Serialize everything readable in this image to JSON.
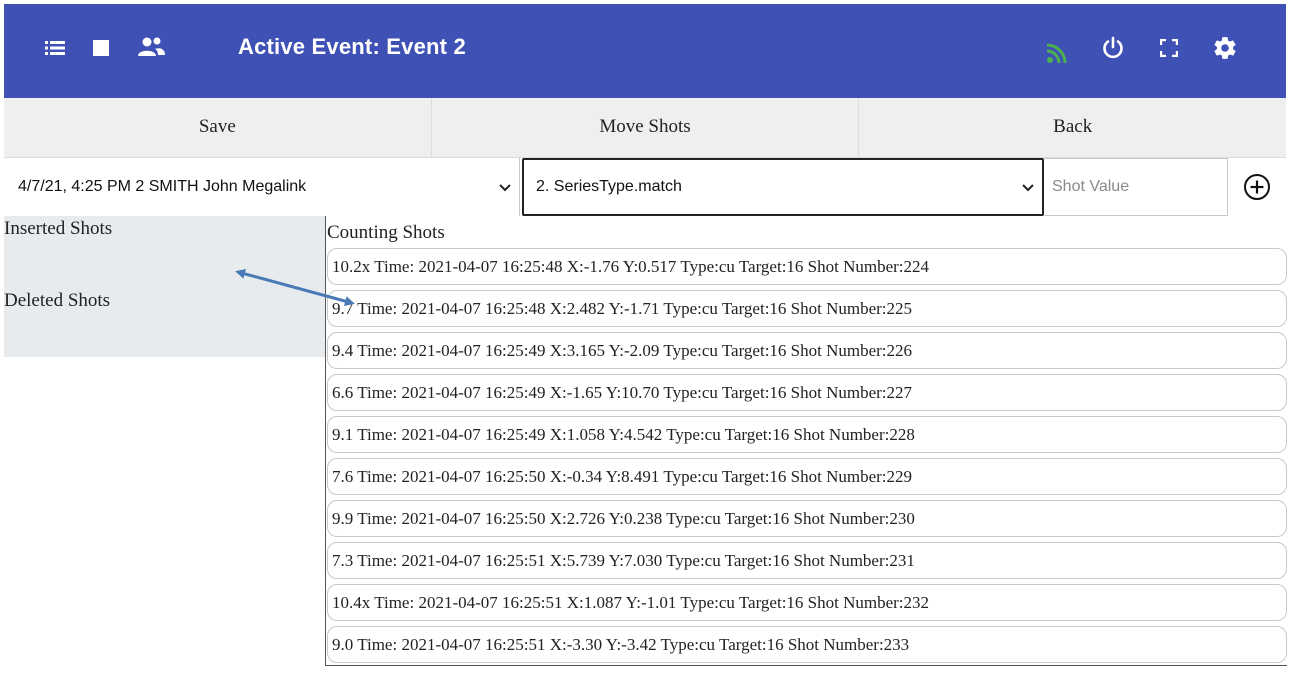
{
  "appbar": {
    "title": "Active Event: Event 2",
    "left_icons": [
      "list-icon",
      "stop-icon",
      "group-icon"
    ],
    "right_icons": [
      "rss-icon",
      "power-icon",
      "fullscreen-icon",
      "gear-icon"
    ],
    "bar_color": "#3f51b5",
    "rss_color": "#4caf50"
  },
  "actions": {
    "save": "Save",
    "move": "Move Shots",
    "back": "Back"
  },
  "selectors": {
    "shooter": "4/7/21, 4:25 PM 2 SMITH John Megalink",
    "series": "2. SeriesType.match",
    "shot_value_placeholder": "Shot Value"
  },
  "left_panel": {
    "inserted": "Inserted Shots",
    "deleted": "Deleted Shots"
  },
  "list": {
    "heading": "Counting Shots",
    "rows": [
      "10.2x Time: 2021-04-07 16:25:48 X:-1.76 Y:0.517 Type:cu Target:16 Shot Number:224",
      "9.7 Time: 2021-04-07 16:25:48 X:2.482 Y:-1.71 Type:cu Target:16 Shot Number:225",
      "9.4 Time: 2021-04-07 16:25:49 X:3.165 Y:-2.09 Type:cu Target:16 Shot Number:226",
      "6.6 Time: 2021-04-07 16:25:49 X:-1.65 Y:10.70 Type:cu Target:16 Shot Number:227",
      "9.1 Time: 2021-04-07 16:25:49 X:1.058 Y:4.542 Type:cu Target:16 Shot Number:228",
      "7.6 Time: 2021-04-07 16:25:50 X:-0.34 Y:8.491 Type:cu Target:16 Shot Number:229",
      "9.9 Time: 2021-04-07 16:25:50 X:2.726 Y:0.238 Type:cu Target:16 Shot Number:230",
      "7.3 Time: 2021-04-07 16:25:51 X:5.739 Y:7.030 Type:cu Target:16 Shot Number:231",
      "10.4x Time: 2021-04-07 16:25:51 X:1.087 Y:-1.01 Type:cu Target:16 Shot Number:232",
      "9.0 Time: 2021-04-07 16:25:51 X:-3.30 Y:-3.42 Type:cu Target:16 Shot Number:233"
    ]
  },
  "annotation_arrow": {
    "color": "#4a7ab5"
  }
}
